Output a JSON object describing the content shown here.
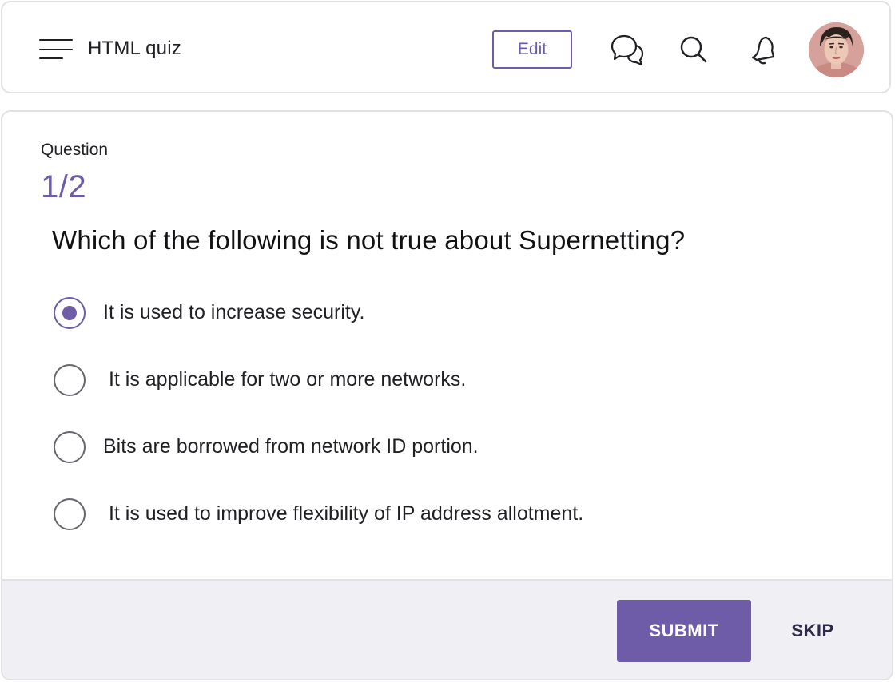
{
  "header": {
    "title": "HTML quiz",
    "edit_label": "Edit",
    "icons": [
      "menu-icon",
      "chat-icon",
      "search-icon",
      "bell-icon"
    ]
  },
  "quiz": {
    "label": "Question",
    "counter": "1/2",
    "question": "Which of the following is not true about Supernetting?",
    "options": [
      {
        "text": "It is used to increase security.",
        "selected": true
      },
      {
        "text": " It is applicable for two or more networks.",
        "selected": false
      },
      {
        "text": "Bits are borrowed from network ID portion.",
        "selected": false
      },
      {
        "text": " It is used to improve flexibility of IP address allotment.",
        "selected": false
      }
    ]
  },
  "footer": {
    "submit_label": "SUBMIT",
    "skip_label": "SKIP"
  },
  "colors": {
    "accent": "#6e5ca8",
    "footer_bg": "#f0eff4",
    "border": "#e2e1e6"
  }
}
